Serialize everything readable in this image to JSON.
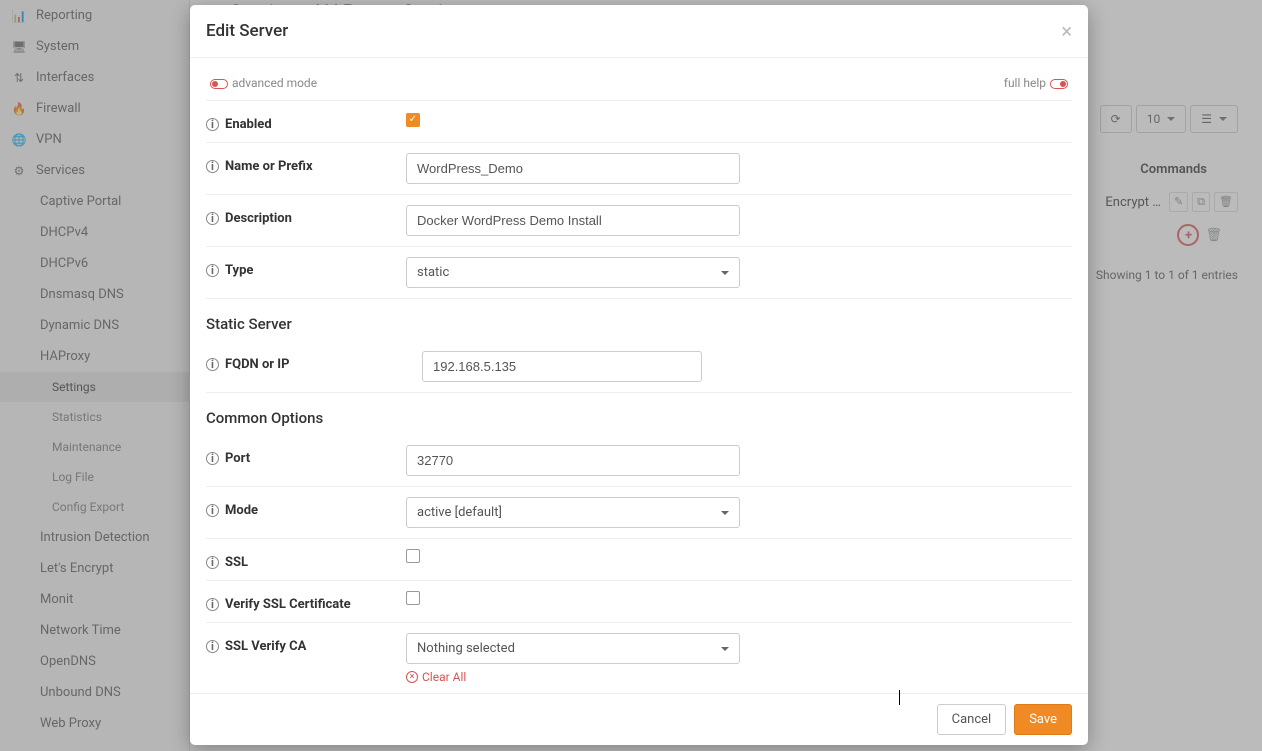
{
  "page_title": "Services: HAProxy: Settings",
  "sidebar": {
    "top": [
      {
        "icon": "📊",
        "label": "Reporting"
      },
      {
        "icon": "🖥",
        "label": "System"
      },
      {
        "icon": "⇅",
        "label": "Interfaces"
      },
      {
        "icon": "🔥",
        "label": "Firewall"
      },
      {
        "icon": "🌐",
        "label": "VPN"
      },
      {
        "icon": "⚙",
        "label": "Services"
      }
    ],
    "services": [
      "Captive Portal",
      "DHCPv4",
      "DHCPv6",
      "Dnsmasq DNS",
      "Dynamic DNS",
      "HAProxy"
    ],
    "haproxy_sub": [
      {
        "label": "Settings",
        "active": true
      },
      {
        "label": "Statistics",
        "active": false
      },
      {
        "label": "Maintenance",
        "active": false
      },
      {
        "label": "Log File",
        "active": false
      },
      {
        "label": "Config Export",
        "active": false
      }
    ],
    "services_rest": [
      "Intrusion Detection",
      "Let's Encrypt",
      "Monit",
      "Network Time",
      "OpenDNS",
      "Unbound DNS",
      "Web Proxy"
    ]
  },
  "toolbar": {
    "page_size": "10"
  },
  "table": {
    "col_commands": "Commands",
    "row_text": "Encrypt …",
    "entries": "Showing 1 to 1 of 1 entries"
  },
  "modal": {
    "title": "Edit Server",
    "advanced": "advanced mode",
    "full_help": "full help",
    "enabled_label": "Enabled",
    "enabled": true,
    "name_label": "Name or Prefix",
    "name_value": "WordPress_Demo",
    "desc_label": "Description",
    "desc_value": "Docker WordPress Demo Install",
    "type_label": "Type",
    "type_value": "static",
    "static_section": "Static Server",
    "fqdn_label": "FQDN or IP",
    "fqdn_value": "192.168.5.135",
    "common_section": "Common Options",
    "port_label": "Port",
    "port_value": "32770",
    "mode_label": "Mode",
    "mode_value": "active [default]",
    "ssl_label": "SSL",
    "ssl_checked": false,
    "verify_label": "Verify SSL Certificate",
    "verify_checked": false,
    "ca_label": "SSL Verify CA",
    "ca_value": "Nothing selected",
    "clear_all": "Clear All",
    "cancel": "Cancel",
    "save": "Save"
  }
}
